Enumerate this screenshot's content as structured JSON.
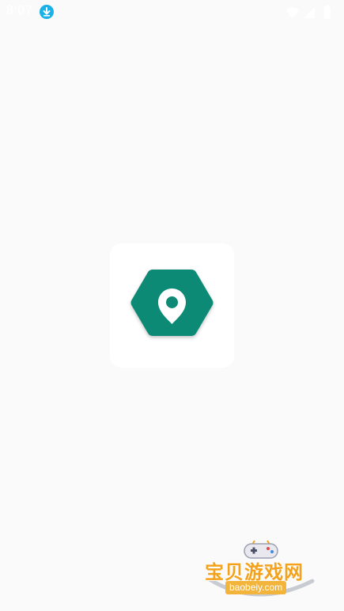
{
  "status_bar": {
    "time": "8:07",
    "icons": [
      "download-icon",
      "wifi-icon",
      "signal-icon",
      "battery-icon"
    ]
  },
  "app_icon": {
    "icon": "location-pin-hexagon-icon",
    "colors": {
      "hexagon": "#0d8a76",
      "pin": "#ffffff",
      "pin_hole": "#0d8a76"
    }
  },
  "watermark": {
    "title": "宝贝游戏网",
    "url": "baobeiy.com",
    "icon": "gamepad-icon"
  },
  "colors": {
    "background": "#fafafa",
    "accent": "#0d8a76",
    "watermark_orange": "#f4a21c"
  }
}
